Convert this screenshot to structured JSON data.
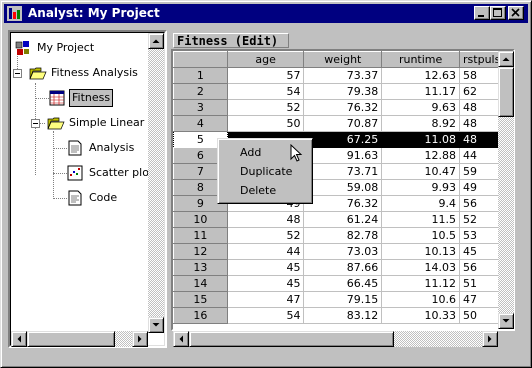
{
  "window": {
    "title": "Analyst: My Project"
  },
  "tree": {
    "items": [
      {
        "label": "My Project",
        "icon": "project-icon"
      },
      {
        "label": "Fitness Analysis",
        "icon": "folder-open-icon"
      },
      {
        "label": "Fitness",
        "icon": "table-icon",
        "selected": true
      },
      {
        "label": "Simple Linear Re",
        "icon": "folder-open-icon"
      },
      {
        "label": "Analysis",
        "icon": "document-icon"
      },
      {
        "label": "Scatter plot o",
        "icon": "scatter-plot-icon"
      },
      {
        "label": "Code",
        "icon": "code-document-icon"
      }
    ]
  },
  "grid": {
    "title": "Fitness (Edit)",
    "columns": [
      "age",
      "weight",
      "runtime",
      "rstpuls"
    ],
    "rows": [
      {
        "n": "1",
        "cells": [
          "57",
          "73.37",
          "12.63",
          "58"
        ]
      },
      {
        "n": "2",
        "cells": [
          "54",
          "79.38",
          "11.17",
          "62"
        ]
      },
      {
        "n": "3",
        "cells": [
          "52",
          "76.32",
          "9.63",
          "48"
        ]
      },
      {
        "n": "4",
        "cells": [
          "50",
          "70.87",
          "8.92",
          "48"
        ]
      },
      {
        "n": "5",
        "cells": [
          "",
          "67.25",
          "11.08",
          "48"
        ]
      },
      {
        "n": "6",
        "cells": [
          "",
          "91.63",
          "12.88",
          "44"
        ]
      },
      {
        "n": "7",
        "cells": [
          "",
          "73.71",
          "10.47",
          "59"
        ]
      },
      {
        "n": "8",
        "cells": [
          "",
          "59.08",
          "9.93",
          "49"
        ]
      },
      {
        "n": "9",
        "cells": [
          "49",
          "76.32",
          "9.4",
          "56"
        ]
      },
      {
        "n": "10",
        "cells": [
          "48",
          "61.24",
          "11.5",
          "52"
        ]
      },
      {
        "n": "11",
        "cells": [
          "52",
          "82.78",
          "10.5",
          "53"
        ]
      },
      {
        "n": "12",
        "cells": [
          "44",
          "73.03",
          "10.13",
          "45"
        ]
      },
      {
        "n": "13",
        "cells": [
          "45",
          "87.66",
          "14.03",
          "56"
        ]
      },
      {
        "n": "14",
        "cells": [
          "45",
          "66.45",
          "11.12",
          "51"
        ]
      },
      {
        "n": "15",
        "cells": [
          "47",
          "79.15",
          "10.6",
          "47"
        ]
      },
      {
        "n": "16",
        "cells": [
          "54",
          "83.12",
          "10.33",
          "50"
        ]
      }
    ],
    "highlighted_row": "5"
  },
  "context_menu": {
    "items": [
      "Add",
      "Duplicate",
      "Delete"
    ]
  }
}
